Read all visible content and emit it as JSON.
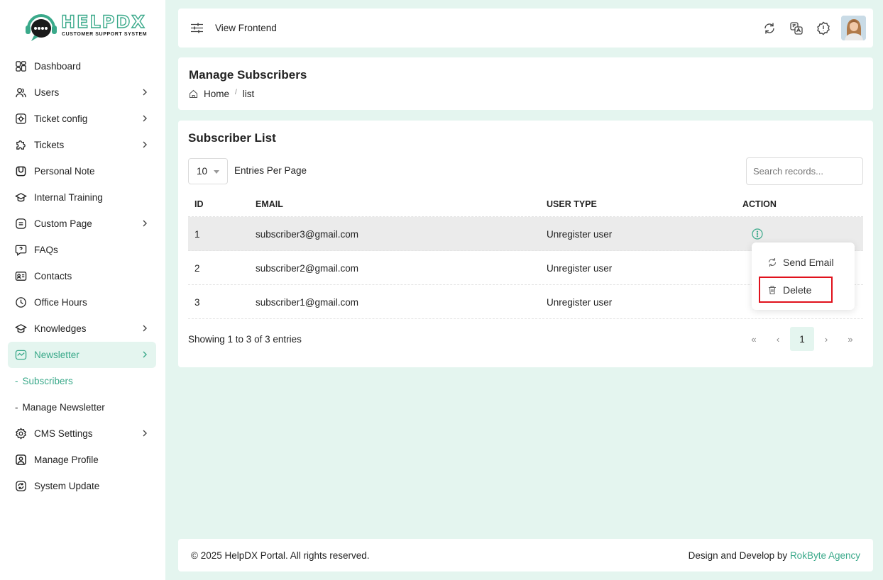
{
  "brand": {
    "name": "HELPDX",
    "tagline": "CUSTOMER SUPPORT SYSTEM",
    "accent": "#3aa98a"
  },
  "sidebar": {
    "items": [
      {
        "label": "Dashboard",
        "icon": "dashboard-icon",
        "chevron": false
      },
      {
        "label": "Users",
        "icon": "users-icon",
        "chevron": true
      },
      {
        "label": "Ticket config",
        "icon": "ticket-config-icon",
        "chevron": true
      },
      {
        "label": "Tickets",
        "icon": "ticket-icon",
        "chevron": true
      },
      {
        "label": "Personal Note",
        "icon": "note-icon",
        "chevron": false
      },
      {
        "label": "Internal Training",
        "icon": "training-icon",
        "chevron": false
      },
      {
        "label": "Custom Page",
        "icon": "page-icon",
        "chevron": true
      },
      {
        "label": "FAQs",
        "icon": "faq-icon",
        "chevron": false
      },
      {
        "label": "Contacts",
        "icon": "contacts-icon",
        "chevron": false
      },
      {
        "label": "Office Hours",
        "icon": "clock-icon",
        "chevron": false
      },
      {
        "label": "Knowledges",
        "icon": "knowledge-icon",
        "chevron": true
      },
      {
        "label": "Newsletter",
        "icon": "newsletter-icon",
        "chevron": true,
        "active": true
      }
    ],
    "subitems": [
      {
        "label": "Subscribers",
        "active": true
      },
      {
        "label": "Manage Newsletter",
        "active": false
      }
    ],
    "bottom_items": [
      {
        "label": "CMS Settings",
        "icon": "settings-icon",
        "chevron": true
      },
      {
        "label": "Manage Profile",
        "icon": "profile-icon",
        "chevron": false
      },
      {
        "label": "System Update",
        "icon": "update-icon",
        "chevron": false
      }
    ]
  },
  "header": {
    "view_frontend": "View Frontend"
  },
  "page": {
    "title": "Manage Subscribers",
    "breadcrumb": {
      "home": "Home",
      "current": "list"
    }
  },
  "list": {
    "title": "Subscriber List",
    "per_page_value": "10",
    "per_page_label": "Entries Per Page",
    "search_placeholder": "Search records...",
    "columns": [
      "ID",
      "EMAIL",
      "USER TYPE",
      "ACTION"
    ],
    "rows": [
      {
        "id": "1",
        "email": "subscriber3@gmail.com",
        "type": "Unregister user"
      },
      {
        "id": "2",
        "email": "subscriber2@gmail.com",
        "type": "Unregister user"
      },
      {
        "id": "3",
        "email": "subscriber1@gmail.com",
        "type": "Unregister user"
      }
    ],
    "dropdown": {
      "send_email": "Send Email",
      "delete": "Delete"
    },
    "showing": "Showing 1 to 3 of 3 entries",
    "pager": {
      "first": "«",
      "prev": "‹",
      "current": "1",
      "next": "›",
      "last": "»"
    }
  },
  "footer": {
    "copyright": "© 2025 HelpDX Portal. All rights reserved.",
    "credit_prefix": "Design and Develop by",
    "credit_link": "RokByte Agency"
  }
}
